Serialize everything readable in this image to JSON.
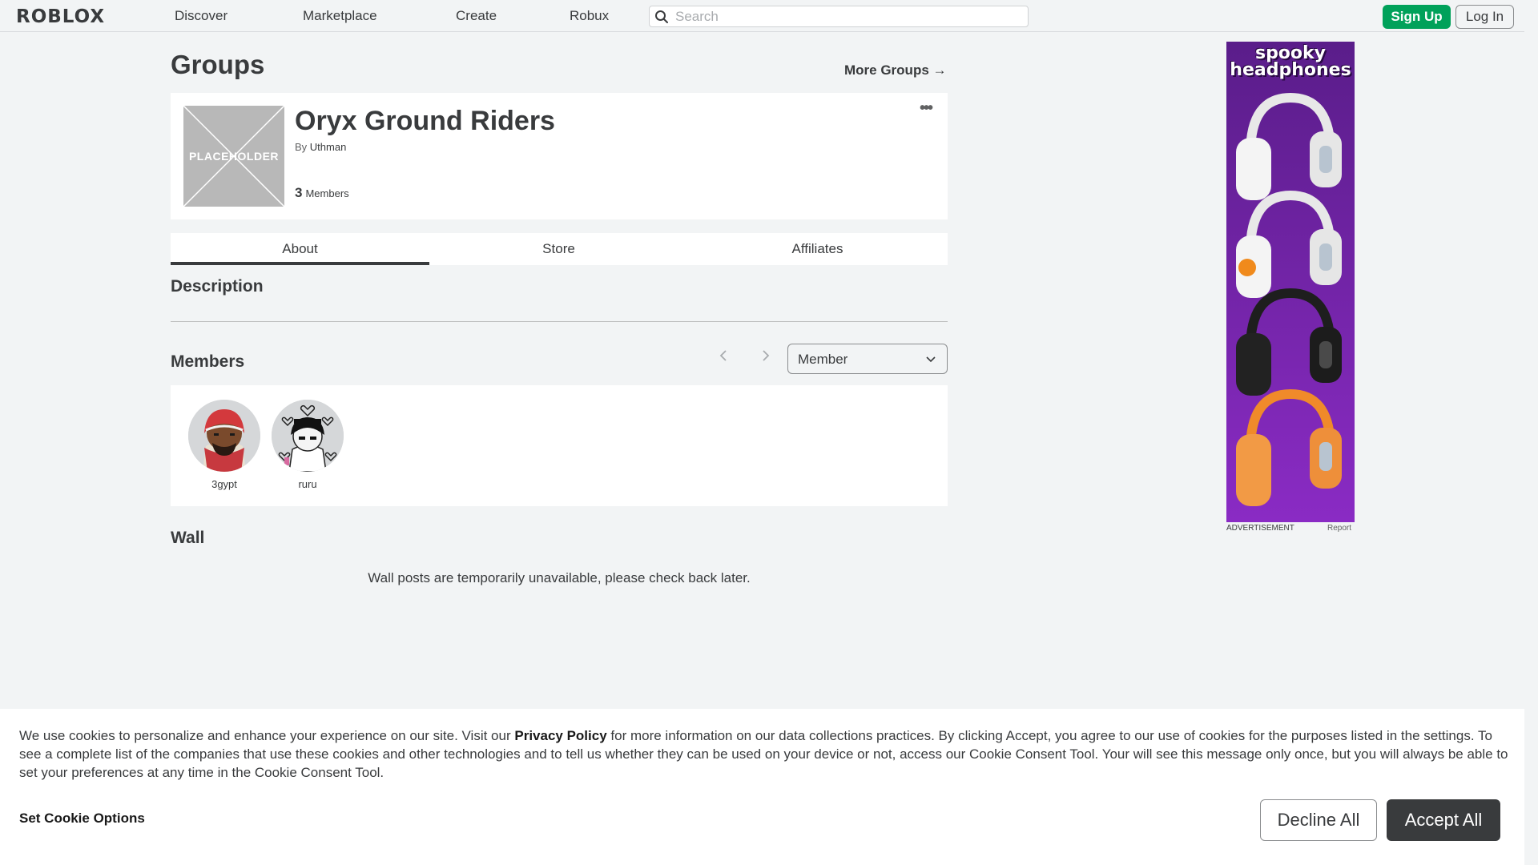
{
  "nav": {
    "logo": "ROBLOX",
    "links": [
      "Discover",
      "Marketplace",
      "Create",
      "Robux"
    ],
    "search_placeholder": "Search",
    "signup_label": "Sign Up",
    "login_label": "Log In"
  },
  "page": {
    "title": "Groups",
    "more_groups_label": "More Groups →"
  },
  "group": {
    "placeholder_text": "PLACEHOLDER",
    "name": "Oryx Ground Riders",
    "by_label": "By",
    "owner": "Uthman",
    "member_count": "3",
    "members_label": "Members",
    "more_icon": "•••"
  },
  "tabs": [
    "About",
    "Store",
    "Affiliates"
  ],
  "sections": {
    "description": "Description",
    "members": "Members",
    "wall": "Wall"
  },
  "members": {
    "role_selected": "Member",
    "list": [
      {
        "name": "3gypt"
      },
      {
        "name": "ruru"
      }
    ]
  },
  "wall": {
    "message": "Wall posts are temporarily unavailable, please check back later."
  },
  "ad": {
    "title_line1": "spooky",
    "title_line2": "headphones",
    "label": "ADVERTISEMENT",
    "report": "Report"
  },
  "cookie": {
    "text_before": "We use cookies to personalize and enhance your experience on our site. Visit our ",
    "privacy_link": "Privacy Policy",
    "text_after": " for more information on our data collections practices. By clicking Accept, you agree to our use of cookies for the purposes listed in the settings. To see a complete list of the companies that use these cookies and other technologies and to tell us whether they can be used on your device or not, access our Cookie Consent Tool. Your will see this message only once, but you will always be able to set your preferences at any time in the Cookie Consent Tool.",
    "options_label": "Set Cookie Options",
    "decline_label": "Decline All",
    "accept_label": "Accept All"
  },
  "colors": {
    "signup_green": "#00a15a",
    "accept_dark": "#393b3d",
    "ad_purple": "#5a1d8a"
  }
}
